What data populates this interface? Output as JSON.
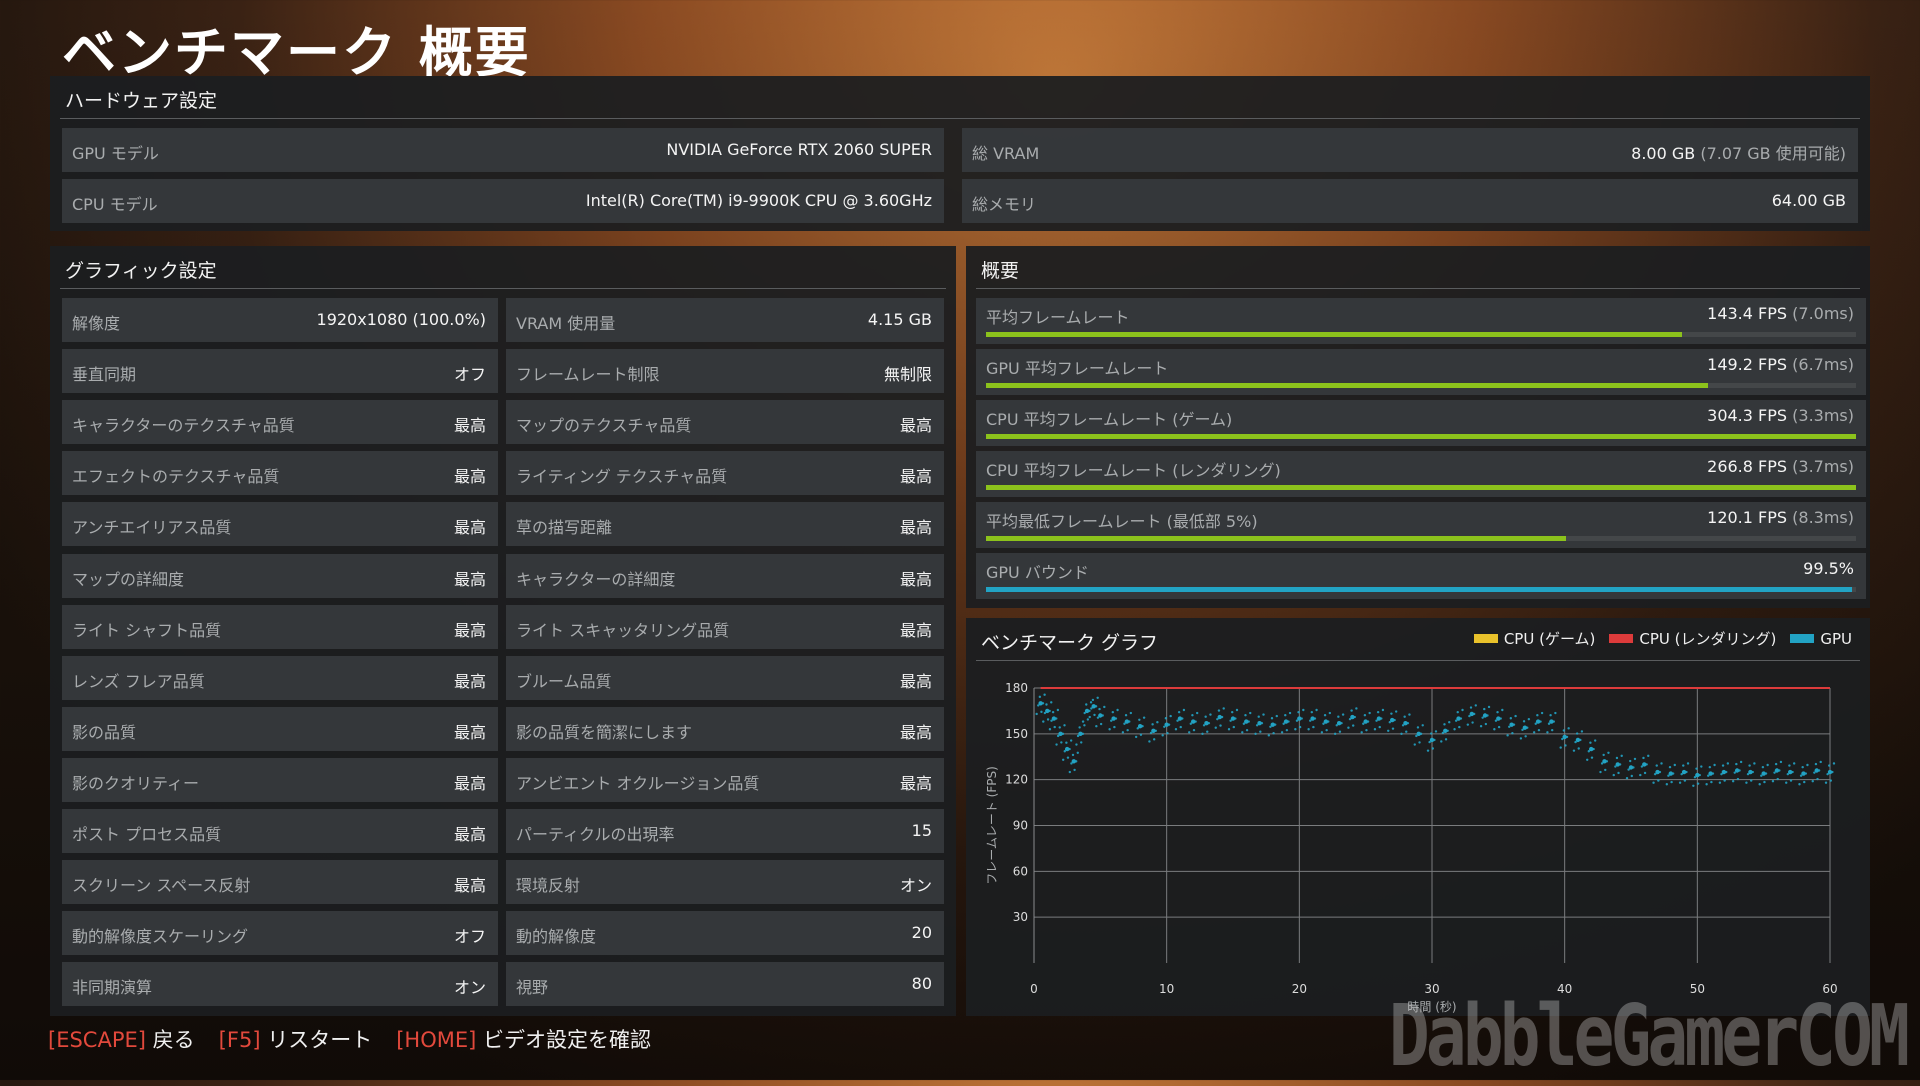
{
  "page_title": "ベンチマーク 概要",
  "hardware": {
    "title": "ハードウェア設定",
    "rows": [
      {
        "label": "GPU モデル",
        "value": "NVIDIA GeForce RTX 2060 SUPER"
      },
      {
        "label": "総 VRAM",
        "value": "8.00 GB",
        "sub": "(7.07 GB 使用可能)"
      },
      {
        "label": "CPU モデル",
        "value": "Intel(R) Core(TM) i9-9900K CPU @ 3.60GHz"
      },
      {
        "label": "総メモリ",
        "value": "64.00 GB"
      }
    ]
  },
  "graphics": {
    "title": "グラフィック設定",
    "left": [
      {
        "label": "解像度",
        "value": "1920x1080 (100.0%)"
      },
      {
        "label": "垂直同期",
        "value": "オフ"
      },
      {
        "label": "キャラクターのテクスチャ品質",
        "value": "最高"
      },
      {
        "label": "エフェクトのテクスチャ品質",
        "value": "最高"
      },
      {
        "label": "アンチエイリアス品質",
        "value": "最高"
      },
      {
        "label": "マップの詳細度",
        "value": "最高"
      },
      {
        "label": "ライト シャフト品質",
        "value": "最高"
      },
      {
        "label": "レンズ フレア品質",
        "value": "最高"
      },
      {
        "label": "影の品質",
        "value": "最高"
      },
      {
        "label": "影のクオリティー",
        "value": "最高"
      },
      {
        "label": "ポスト プロセス品質",
        "value": "最高"
      },
      {
        "label": "スクリーン スペース反射",
        "value": "最高"
      },
      {
        "label": "動的解像度スケーリング",
        "value": "オフ"
      },
      {
        "label": "非同期演算",
        "value": "オン"
      }
    ],
    "right": [
      {
        "label": "VRAM 使用量",
        "value": "4.15 GB"
      },
      {
        "label": "フレームレート制限",
        "value": "無制限"
      },
      {
        "label": "マップのテクスチャ品質",
        "value": "最高"
      },
      {
        "label": "ライティング テクスチャ品質",
        "value": "最高"
      },
      {
        "label": "草の描写距離",
        "value": "最高"
      },
      {
        "label": "キャラクターの詳細度",
        "value": "最高"
      },
      {
        "label": "ライト スキャッタリング品質",
        "value": "最高"
      },
      {
        "label": "ブルーム品質",
        "value": "最高"
      },
      {
        "label": "影の品質を簡潔にします",
        "value": "最高"
      },
      {
        "label": "アンビエント オクルージョン品質",
        "value": "最高"
      },
      {
        "label": "パーティクルの出現率",
        "value": "15"
      },
      {
        "label": "環境反射",
        "value": "オン"
      },
      {
        "label": "動的解像度",
        "value": "20"
      },
      {
        "label": "視野",
        "value": "80"
      }
    ]
  },
  "summary": {
    "title": "概要",
    "rows": [
      {
        "label": "平均フレームレート",
        "value": "143.4 FPS",
        "sub": "(7.0ms)",
        "fraction": 0.8,
        "color": "#8cc21c"
      },
      {
        "label": "GPU 平均フレームレート",
        "value": "149.2 FPS",
        "sub": "(6.7ms)",
        "fraction": 0.83,
        "color": "#8cc21c"
      },
      {
        "label": "CPU 平均フレームレート (ゲーム)",
        "value": "304.3 FPS",
        "sub": "(3.3ms)",
        "fraction": 1.0,
        "color": "#8cc21c"
      },
      {
        "label": "CPU 平均フレームレート (レンダリング)",
        "value": "266.8 FPS",
        "sub": "(3.7ms)",
        "fraction": 1.0,
        "color": "#8cc21c"
      },
      {
        "label": "平均最低フレームレート (最低部 5%)",
        "value": "120.1 FPS",
        "sub": "(8.3ms)",
        "fraction": 0.667,
        "color": "#8cc21c"
      },
      {
        "label": "GPU バウンド",
        "value": "99.5%",
        "sub": "",
        "fraction": 0.995,
        "color": "#22a3c4"
      }
    ]
  },
  "graph": {
    "title": "ベンチマーク グラフ",
    "legend": [
      {
        "name": "CPU (ゲーム)",
        "color": "#e9c22b"
      },
      {
        "name": "CPU (レンダリング)",
        "color": "#dd3b3b"
      },
      {
        "name": "GPU",
        "color": "#22a3c4"
      }
    ]
  },
  "chart_data": {
    "type": "scatter",
    "xlabel": "時間 (秒)",
    "ylabel": "フレームレート (FPS)",
    "xlim": [
      0,
      60
    ],
    "ylim": [
      0,
      180
    ],
    "xticks": [
      0,
      10,
      20,
      30,
      40,
      50,
      60
    ],
    "yticks": [
      30,
      60,
      90,
      120,
      150,
      180
    ],
    "grid": true,
    "legend_position": "top-right",
    "series": [
      {
        "name": "CPU (ゲーム)",
        "color": "#e9c22b",
        "summary": "above 180 (off-scale)"
      },
      {
        "name": "CPU (レンダリング)",
        "color": "#dd3b3b",
        "summary": "mostly at ~180 ceiling, sparse outliers"
      },
      {
        "name": "GPU",
        "color": "#22a3c4",
        "x": [
          0.5,
          1,
          1.5,
          2,
          2.5,
          3,
          3.5,
          4,
          4.5,
          5,
          6,
          7,
          8,
          9,
          10,
          11,
          12,
          13,
          14,
          15,
          16,
          17,
          18,
          19,
          20,
          21,
          22,
          23,
          24,
          25,
          26,
          27,
          28,
          29,
          30,
          31,
          32,
          33,
          34,
          35,
          36,
          37,
          38,
          39,
          40,
          41,
          42,
          43,
          44,
          45,
          46,
          47,
          48,
          49,
          50,
          51,
          52,
          53,
          54,
          55,
          56,
          57,
          58,
          59,
          60
        ],
        "y": [
          170,
          165,
          160,
          150,
          140,
          132,
          150,
          165,
          168,
          162,
          160,
          158,
          155,
          152,
          156,
          160,
          158,
          157,
          161,
          160,
          158,
          157,
          156,
          158,
          160,
          160,
          158,
          157,
          161,
          158,
          160,
          159,
          157,
          150,
          146,
          152,
          160,
          163,
          162,
          160,
          156,
          154,
          158,
          158,
          148,
          146,
          140,
          132,
          130,
          128,
          130,
          125,
          124,
          125,
          123,
          124,
          125,
          126,
          125,
          124,
          126,
          125,
          124,
          126,
          125
        ]
      }
    ]
  },
  "footer": [
    {
      "key": "ESCAPE",
      "label": "戻る"
    },
    {
      "key": "F5",
      "label": "リスタート"
    },
    {
      "key": "HOME",
      "label": "ビデオ設定を確認"
    }
  ],
  "watermark": "DabbleGamerCOM"
}
